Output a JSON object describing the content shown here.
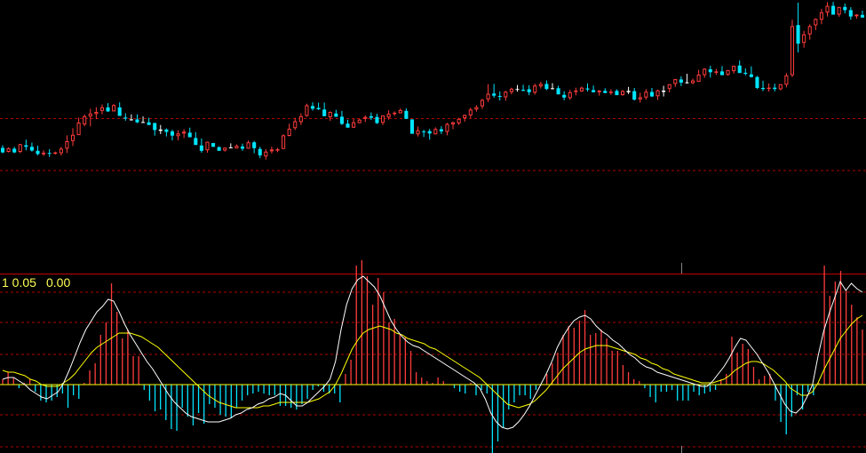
{
  "indicator_labels": [
    "1 0.05",
    "0.00"
  ],
  "colors": {
    "background": "#000000",
    "up": "#ff3c3c",
    "down": "#00e5ff",
    "doji": "#ffffff",
    "grid": "#b00000",
    "separator": "#c00000",
    "line_fast": "#ffffff",
    "line_slow": "#ffff00",
    "label": "#ffff55"
  },
  "chart_data": [
    {
      "type": "candlestick",
      "title": "",
      "price_range": [
        0,
        100
      ],
      "gridlines": [
        36,
        55.5
      ],
      "candles": [
        [
          44.5,
          45.5,
          42.5,
          42.8
        ],
        [
          43.0,
          44.7,
          42.8,
          44.4
        ],
        [
          44.2,
          44.9,
          42.5,
          42.8
        ],
        [
          43.0,
          46.0,
          42.5,
          45.9
        ],
        [
          45.5,
          47.6,
          43.6,
          44.9
        ],
        [
          44.9,
          46.5,
          43.1,
          43.5
        ],
        [
          43.4,
          45.3,
          41.7,
          42.2
        ],
        [
          42.1,
          43.6,
          41.5,
          42.7
        ],
        [
          42.6,
          44.0,
          41.1,
          42.4
        ],
        [
          42.4,
          43.1,
          42.0,
          42.8
        ],
        [
          42.5,
          44.9,
          41.6,
          44.2
        ],
        [
          44.2,
          49.2,
          42.6,
          47.0
        ],
        [
          47.1,
          51.9,
          45.2,
          49.4
        ],
        [
          49.3,
          55.9,
          49.5,
          54.0
        ],
        [
          53.3,
          57.0,
          52.6,
          56.4
        ],
        [
          56.3,
          59.2,
          52.6,
          57.4
        ],
        [
          57.2,
          59.8,
          55.3,
          58.0
        ],
        [
          58.4,
          60.8,
          57.1,
          59.7
        ],
        [
          59.7,
          61.3,
          58.0,
          58.2
        ],
        [
          58.2,
          60.9,
          58.6,
          60.6
        ],
        [
          59.7,
          61.6,
          57.5,
          56.5
        ],
        [
          55.9,
          57.5,
          54.7,
          55.5
        ],
        [
          55.2,
          57.1,
          54.7,
          55.2
        ],
        [
          55.2,
          57.1,
          53.8,
          54.1
        ],
        [
          54.2,
          56.3,
          53.9,
          54.2
        ],
        [
          54.1,
          55.8,
          53.2,
          53.1
        ],
        [
          53.8,
          54.0,
          49.1,
          51.2
        ],
        [
          51.3,
          53.1,
          49.7,
          51.4
        ],
        [
          51.4,
          51.8,
          48.8,
          50.5
        ],
        [
          50.7,
          51.3,
          47.3,
          49.1
        ],
        [
          48.9,
          51.1,
          47.3,
          49.9
        ],
        [
          49.9,
          51.5,
          48.2,
          50.6
        ],
        [
          50.2,
          52.1,
          48.8,
          48.5
        ],
        [
          48.2,
          50.4,
          46.1,
          45.6
        ],
        [
          45.4,
          48.0,
          42.7,
          43.4
        ],
        [
          43.6,
          45.7,
          42.7,
          46.8
        ],
        [
          46.3,
          46.4,
          45.4,
          44.9
        ],
        [
          44.8,
          45.1,
          44.6,
          43.4
        ],
        [
          43.5,
          44.4,
          43.1,
          44.6
        ],
        [
          44.7,
          46.2,
          44.4,
          44.7
        ],
        [
          44.3,
          45.8,
          44.4,
          45.3
        ],
        [
          45.0,
          46.1,
          43.4,
          44.2
        ],
        [
          44.2,
          47.3,
          44.3,
          46.6
        ],
        [
          46.6,
          47.1,
          42.5,
          44.4
        ],
        [
          44.1,
          44.9,
          40.7,
          41.7
        ],
        [
          41.3,
          44.0,
          40.1,
          43.1
        ],
        [
          43.2,
          45.0,
          42.4,
          43.9
        ],
        [
          43.7,
          44.5,
          42.9,
          44.0
        ],
        [
          44.1,
          49.6,
          44.3,
          49.2
        ],
        [
          49.0,
          53.6,
          48.8,
          51.7
        ],
        [
          51.9,
          55.8,
          51.2,
          54.5
        ],
        [
          54.2,
          57.5,
          53.1,
          56.4
        ],
        [
          56.5,
          61.1,
          56.2,
          60.5
        ],
        [
          60.2,
          61.6,
          58.5,
          59.2
        ],
        [
          59.5,
          61.5,
          58.7,
          59.0
        ],
        [
          58.9,
          61.5,
          58.5,
          56.4
        ],
        [
          56.0,
          58.2,
          54.6,
          58.0
        ],
        [
          57.4,
          58.8,
          56.1,
          56.2
        ],
        [
          56.2,
          58.4,
          53.1,
          53.5
        ],
        [
          53.6,
          55.1,
          52.2,
          52.1
        ],
        [
          52.1,
          55.5,
          52.0,
          54.1
        ],
        [
          53.8,
          55.4,
          53.8,
          55.1
        ],
        [
          55.4,
          56.7,
          54.2,
          56.1
        ],
        [
          56.4,
          57.8,
          55.0,
          55.8
        ],
        [
          56.1,
          57.3,
          53.5,
          53.8
        ],
        [
          53.9,
          56.6,
          53.1,
          56.7
        ],
        [
          55.9,
          58.6,
          55.1,
          57.3
        ],
        [
          57.4,
          58.2,
          56.5,
          57.7
        ],
        [
          57.5,
          59.4,
          57.7,
          58.7
        ],
        [
          58.4,
          59.3,
          55.7,
          55.4
        ],
        [
          55.2,
          54.1,
          51.9,
          49.8
        ],
        [
          49.6,
          52.5,
          48.8,
          51.1
        ],
        [
          50.7,
          51.3,
          48.6,
          50.5
        ],
        [
          50.8,
          51.6,
          47.6,
          49.9
        ],
        [
          49.6,
          52.2,
          49.9,
          51.6
        ],
        [
          51.5,
          52.6,
          49.7,
          50.7
        ],
        [
          50.5,
          53.9,
          49.2,
          53.5
        ],
        [
          53.3,
          54.4,
          51.5,
          54.1
        ],
        [
          53.7,
          55.8,
          53.1,
          55.4
        ],
        [
          55.6,
          57.0,
          54.3,
          56.9
        ],
        [
          56.7,
          59.6,
          55.7,
          58.9
        ],
        [
          58.9,
          60.5,
          58.1,
          59.8
        ],
        [
          60.1,
          62.9,
          59.1,
          62.5
        ],
        [
          62.7,
          68.4,
          61.7,
          64.8
        ],
        [
          64.9,
          68.5,
          63.3,
          64.1
        ],
        [
          64.0,
          65.7,
          62.3,
          63.7
        ],
        [
          63.5,
          65.9,
          62.2,
          65.6
        ],
        [
          65.4,
          67.1,
          64.6,
          66.7
        ],
        [
          66.6,
          68.1,
          65.6,
          66.5
        ],
        [
          66.3,
          68.2,
          65.8,
          65.9
        ],
        [
          66.5,
          68.0,
          64.3,
          65.4
        ],
        [
          65.2,
          68.6,
          64.5,
          67.9
        ],
        [
          67.6,
          69.3,
          66.8,
          68.5
        ],
        [
          68.5,
          69.8,
          66.2,
          66.6
        ],
        [
          66.9,
          68.8,
          66.4,
          66.9
        ],
        [
          66.9,
          67.8,
          64.9,
          64.6
        ],
        [
          64.4,
          65.8,
          62.4,
          63.4
        ],
        [
          63.2,
          66.3,
          62.6,
          65.4
        ],
        [
          65.5,
          67.1,
          64.2,
          66.0
        ],
        [
          65.7,
          67.5,
          65.5,
          67.1
        ],
        [
          66.8,
          68.7,
          65.7,
          66.4
        ],
        [
          66.2,
          67.9,
          65.3,
          65.4
        ],
        [
          65.4,
          66.2,
          64.1,
          66.0
        ],
        [
          65.9,
          66.9,
          65.0,
          65.1
        ],
        [
          65.1,
          66.5,
          64.4,
          65.6
        ],
        [
          65.9,
          66.5,
          64.3,
          64.3
        ],
        [
          64.3,
          66.2,
          64.1,
          65.9
        ],
        [
          65.8,
          67.4,
          64.7,
          65.9
        ],
        [
          65.8,
          67.0,
          62.3,
          62.6
        ],
        [
          62.7,
          65.2,
          61.5,
          63.5
        ],
        [
          63.4,
          66.6,
          62.6,
          65.6
        ],
        [
          65.5,
          67.0,
          63.6,
          63.8
        ],
        [
          63.9,
          66.3,
          62.5,
          66.1
        ],
        [
          65.9,
          67.8,
          63.8,
          66.0
        ],
        [
          66.6,
          68.1,
          65.3,
          68.4
        ],
        [
          68.5,
          70.4,
          67.4,
          70.3
        ],
        [
          70.2,
          71.4,
          67.7,
          69.0
        ],
        [
          69.1,
          72.3,
          68.6,
          69.0
        ],
        [
          68.8,
          70.5,
          68.4,
          69.8
        ],
        [
          69.3,
          73.8,
          69.4,
          72.0
        ],
        [
          71.8,
          74.4,
          70.8,
          74.2
        ],
        [
          74.0,
          75.3,
          70.9,
          72.9
        ],
        [
          72.7,
          74.1,
          71.9,
          73.2
        ],
        [
          73.2,
          75.2,
          72.0,
          71.8
        ],
        [
          71.9,
          73.7,
          71.6,
          73.7
        ],
        [
          73.3,
          75.1,
          72.4,
          75.3
        ],
        [
          75.4,
          77.3,
          72.8,
          72.6
        ],
        [
          72.7,
          74.3,
          71.7,
          72.3
        ],
        [
          72.1,
          75.1,
          70.9,
          71.1
        ],
        [
          71.1,
          71.5,
          66.6,
          67.0
        ],
        [
          67.0,
          69.7,
          65.8,
          66.6
        ],
        [
          66.6,
          68.7,
          65.6,
          67.1
        ],
        [
          67.1,
          68.6,
          65.7,
          66.6
        ],
        [
          66.5,
          67.3,
          66.1,
          68.4
        ],
        [
          68.2,
          72.6,
          67.2,
          71.7
        ],
        [
          71.8,
          92.6,
          71.1,
          90.2
        ],
        [
          90.6,
          99.0,
          80.3,
          83.6
        ],
        [
          83.9,
          88.4,
          82.1,
          87.1
        ],
        [
          87.1,
          90.9,
          85.1,
          90.2
        ],
        [
          90.5,
          93.1,
          88.7,
          92.9
        ],
        [
          92.6,
          96.7,
          90.9,
          95.4
        ],
        [
          95.3,
          99.2,
          93.8,
          97.8
        ],
        [
          97.8,
          99.3,
          94.9,
          94.5
        ],
        [
          94.5,
          97.4,
          93.7,
          97.4
        ],
        [
          97.4,
          98.7,
          95.0,
          96.2
        ],
        [
          96.2,
          97.3,
          92.6,
          93.8
        ],
        [
          93.9,
          94.7,
          93.0,
          94.5
        ],
        [
          94.4,
          96.0,
          93.4,
          93.4
        ]
      ]
    },
    {
      "type": "bar+line",
      "title": "",
      "zero": 0,
      "range": [
        -5,
        13.5
      ],
      "gridlines": [
        1.7,
        3.5,
        5.2,
        -1.7,
        -3.5
      ],
      "histogram": [
        0.3,
        0.7,
        0.4,
        -0.2,
        0.1,
        0.3,
        -0.4,
        -0.9,
        -1.0,
        -0.9,
        -0.7,
        -0.5,
        -1.3,
        -0.6,
        -0.8,
        0.1,
        0.8,
        1.2,
        2.8,
        3.5,
        5.7,
        4.1,
        2.6,
        3.1,
        1.6,
        1.6,
        -0.3,
        -0.9,
        -1.5,
        -1.4,
        -2.0,
        -2.5,
        -2.6,
        -1.3,
        -1.8,
        -2.3,
        -1.6,
        -2.2,
        -1.1,
        -1.3,
        -1.7,
        -1.8,
        -1.9,
        -1.3,
        -0.9,
        -0.6,
        -0.5,
        -0.4,
        -0.5,
        -0.6,
        -0.6,
        -1.2,
        -1.2,
        -1.3,
        -1.4,
        -1.1,
        -0.8,
        -0.3,
        -0.1,
        -0.4,
        -0.5,
        -0.5,
        -1.0,
        0.6,
        1.4,
        6.7,
        7.0,
        6.1,
        4.5,
        6.0,
        5.2,
        3.5,
        3.7,
        2.8,
        2.7,
        1.9,
        0.7,
        0.4,
        0.2,
        0.1,
        0.4,
        0.2,
        0.0,
        -0.2,
        -0.4,
        -0.5,
        0.1,
        -0.6,
        -0.3,
        -0.5,
        -4.3,
        -3.2,
        -2.4,
        -1.4,
        -1.0,
        -0.6,
        -0.6,
        -0.8,
        -0.3,
        0.0,
        0.6,
        1.2,
        1.8,
        2.8,
        3.3,
        3.2,
        3.6,
        4.2,
        2.8,
        2.9,
        3.1,
        2.6,
        1.9,
        1.9,
        1.1,
        0.7,
        0.3,
        0.2,
        -0.2,
        -0.7,
        -1.0,
        -0.4,
        -0.4,
        -0.3,
        -0.9,
        -0.9,
        -0.9,
        -0.4,
        -0.6,
        -0.5,
        -0.4,
        -0.3,
        0.3,
        0.6,
        2.7,
        1.8,
        2.3,
        2.0,
        1.0,
        0.3,
        0.5,
        0.6,
        -0.9,
        -2.1,
        -2.8,
        -1.8,
        -0.6,
        -1.4,
        -0.4,
        -0.6,
        0.1,
        6.7,
        5.0,
        5.8,
        6.4,
        5.3,
        4.5,
        3.8,
        3.1
      ],
      "fast_line": [
        0.3,
        0.4,
        0.4,
        0.2,
        0.0,
        -0.3,
        -0.5,
        -0.7,
        -0.8,
        -0.6,
        -0.4,
        0.1,
        0.8,
        1.6,
        2.4,
        3.1,
        3.6,
        4.1,
        4.4,
        4.8,
        4.7,
        4.1,
        3.4,
        2.8,
        2.3,
        1.8,
        1.3,
        0.9,
        0.4,
        -0.1,
        -0.6,
        -1.0,
        -1.3,
        -1.6,
        -1.8,
        -1.9,
        -2.0,
        -2.1,
        -2.1,
        -2.1,
        -2.0,
        -1.9,
        -1.7,
        -1.6,
        -1.4,
        -1.3,
        -1.1,
        -1.0,
        -0.8,
        -0.7,
        -0.5,
        -0.6,
        -0.9,
        -1.2,
        -1.2,
        -1.0,
        -0.7,
        -0.4,
        -0.1,
        0.3,
        1.3,
        3.1,
        4.5,
        5.4,
        5.9,
        6.1,
        5.8,
        5.5,
        5.0,
        4.3,
        3.6,
        3.1,
        2.7,
        2.4,
        2.2,
        2.1,
        1.9,
        1.7,
        1.5,
        1.3,
        1.1,
        0.9,
        0.7,
        0.5,
        0.3,
        0.1,
        -0.2,
        -0.8,
        -1.6,
        -2.1,
        -2.4,
        -2.5,
        -2.4,
        -2.1,
        -1.7,
        -1.2,
        -0.6,
        0.0,
        0.6,
        1.3,
        2.1,
        2.7,
        3.2,
        3.6,
        3.8,
        3.9,
        3.7,
        3.3,
        3.0,
        2.8,
        2.5,
        2.3,
        2.0,
        1.7,
        1.5,
        1.2,
        1.0,
        0.9,
        0.7,
        0.6,
        0.5,
        0.4,
        0.3,
        0.2,
        0.1,
        0.0,
        -0.1,
        -0.1,
        0.2,
        0.6,
        1.0,
        1.5,
        2.1,
        2.6,
        2.5,
        2.1,
        1.7,
        1.2,
        0.7,
        0.1,
        -0.5,
        -1.1,
        -1.5,
        -1.6,
        -1.3,
        -0.7,
        0.0,
        1.6,
        3.0,
        4.0,
        4.9,
        5.8,
        5.3,
        5.7,
        5.4,
        5.2
      ],
      "slow_line": [
        0.8,
        0.7,
        0.7,
        0.6,
        0.5,
        0.3,
        0.2,
        0.0,
        -0.1,
        -0.1,
        -0.1,
        0.1,
        0.3,
        0.6,
        1.0,
        1.4,
        1.8,
        2.1,
        2.3,
        2.5,
        2.7,
        2.9,
        2.9,
        2.9,
        2.8,
        2.7,
        2.5,
        2.3,
        2.1,
        1.8,
        1.5,
        1.2,
        0.9,
        0.6,
        0.3,
        0.0,
        -0.3,
        -0.6,
        -0.8,
        -1.0,
        -1.1,
        -1.2,
        -1.3,
        -1.3,
        -1.3,
        -1.3,
        -1.3,
        -1.2,
        -1.2,
        -1.1,
        -1.0,
        -1.0,
        -1.0,
        -1.0,
        -1.0,
        -1.0,
        -0.9,
        -0.8,
        -0.6,
        -0.4,
        0.0,
        0.6,
        1.3,
        2.0,
        2.5,
        2.9,
        3.1,
        3.2,
        3.3,
        3.2,
        3.1,
        2.9,
        2.8,
        2.6,
        2.5,
        2.4,
        2.3,
        2.1,
        2.0,
        1.8,
        1.6,
        1.4,
        1.2,
        1.0,
        0.8,
        0.6,
        0.4,
        0.1,
        -0.2,
        -0.5,
        -0.8,
        -1.1,
        -1.2,
        -1.3,
        -1.2,
        -1.1,
        -0.9,
        -0.6,
        -0.3,
        0.1,
        0.5,
        0.9,
        1.2,
        1.5,
        1.8,
        2.0,
        2.1,
        2.2,
        2.2,
        2.2,
        2.1,
        2.0,
        1.9,
        1.8,
        1.7,
        1.5,
        1.4,
        1.2,
        1.1,
        0.9,
        0.8,
        0.6,
        0.5,
        0.4,
        0.3,
        0.2,
        0.1,
        0.1,
        0.1,
        0.2,
        0.3,
        0.5,
        0.8,
        1.0,
        1.2,
        1.3,
        1.3,
        1.2,
        1.0,
        0.8,
        0.5,
        0.2,
        -0.2,
        -0.4,
        -0.6,
        -0.6,
        -0.4,
        0.1,
        0.8,
        1.4,
        2.0,
        2.6,
        3.0,
        3.4,
        3.7,
        3.9
      ]
    }
  ]
}
